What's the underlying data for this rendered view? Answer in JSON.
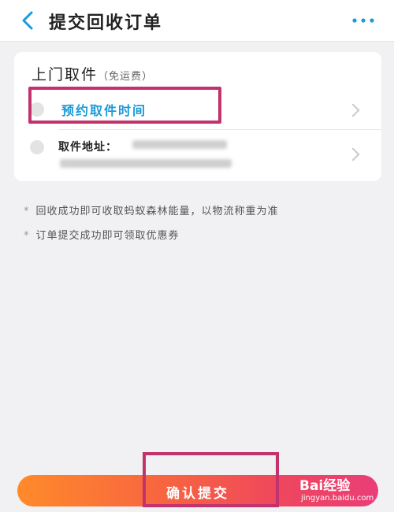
{
  "header": {
    "title": "提交回收订单",
    "back_icon": "chevron-left-icon",
    "more_icon": "more-dots-icon",
    "accent_color": "#1a9bd8"
  },
  "pickup_card": {
    "title": "上门取件",
    "subtitle": "（免运费）",
    "time_row": {
      "label": "预约取件时间",
      "icon": "clock-icon"
    },
    "address_row": {
      "label": "取件地址：",
      "icon": "location-icon"
    }
  },
  "notes": [
    {
      "bullet": "*",
      "text": "回收成功即可收取蚂蚁森林能量，以物流称重为准"
    },
    {
      "bullet": "*",
      "text": "订单提交成功即可领取优惠券"
    }
  ],
  "footer": {
    "submit_label": "确认提交"
  },
  "watermark": {
    "logo": "Bai经验",
    "url": "jingyan.baidu.com"
  },
  "highlight_color": "#c2326d"
}
